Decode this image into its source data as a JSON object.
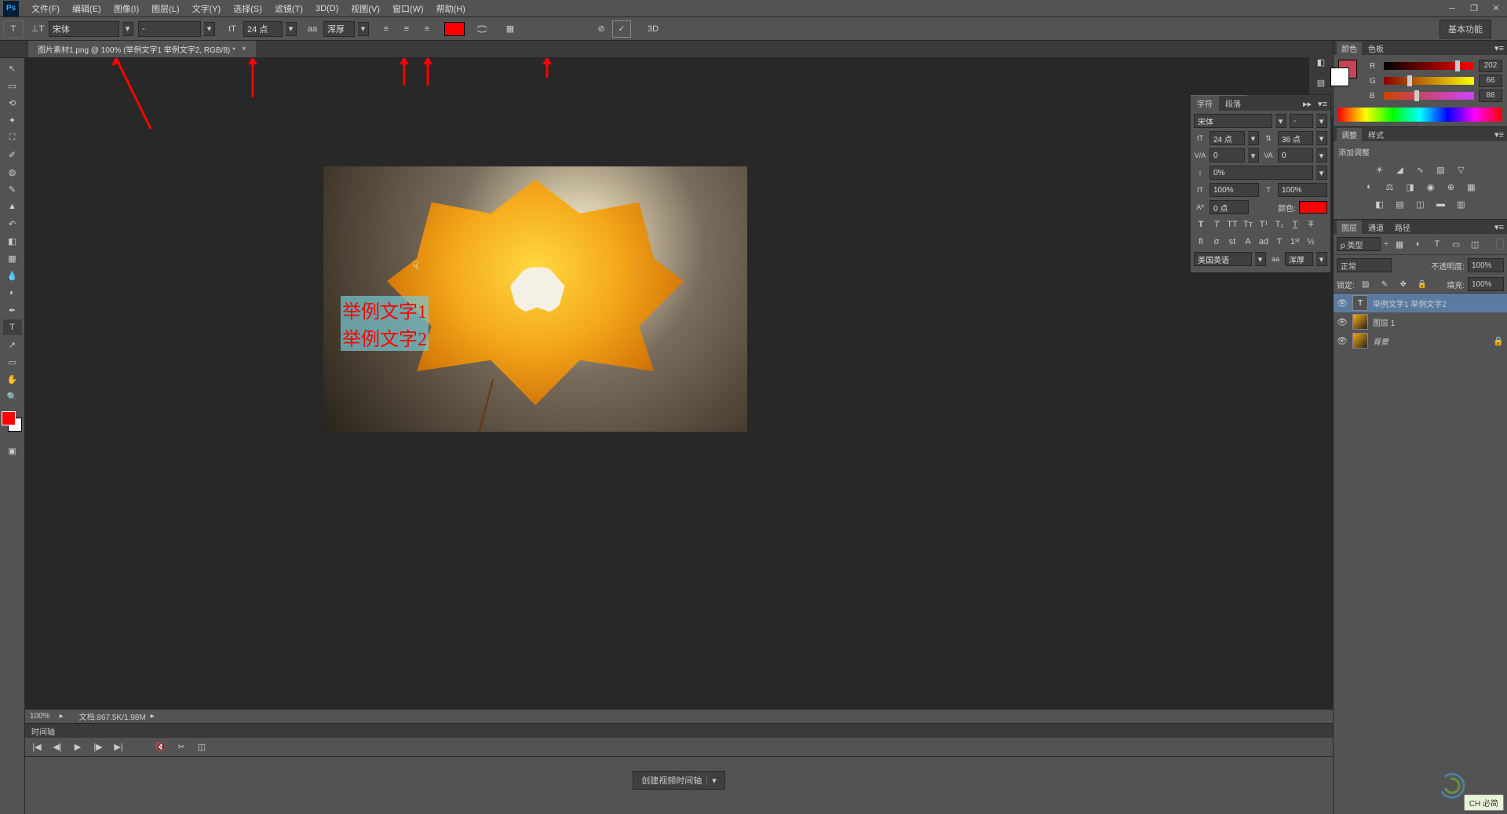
{
  "menubar": {
    "logo": "Ps",
    "items": [
      "文件(F)",
      "编辑(E)",
      "图像(I)",
      "图层(L)",
      "文字(Y)",
      "选择(S)",
      "滤镜(T)",
      "3D(D)",
      "视图(V)",
      "窗口(W)",
      "帮助(H)"
    ]
  },
  "optionsbar": {
    "font_family": "宋体",
    "font_style": "-",
    "font_size": "24 点",
    "aa_label": "aa",
    "aa_value": "浑厚",
    "threeD": "3D",
    "workspace": "基本功能"
  },
  "document": {
    "tab_title": "图片素材1.png @ 100% (举例文字1 举例文字2, RGB/8) *",
    "text1": "举例文字1",
    "text2": "举例文字2"
  },
  "statusbar": {
    "zoom": "100%",
    "docinfo": "文档:867.5K/1.98M"
  },
  "timeline": {
    "title": "时间轴",
    "create_btn": "创建视频时间轴"
  },
  "char_panel": {
    "tab1": "字符",
    "tab2": "段落",
    "font": "宋体",
    "style": "-",
    "size": "24 点",
    "leading": "36 点",
    "tracking": "0",
    "va": "0",
    "scale_label": "0%",
    "scale_h": "100%",
    "scale_v": "100%",
    "baseline": "0 点",
    "color_label": "颜色:",
    "lang": "美国英语",
    "aa": "浑厚"
  },
  "color_panel": {
    "tab1": "颜色",
    "tab2": "色板",
    "r_label": "R",
    "r_val": "202",
    "g_label": "G",
    "g_val": "66",
    "b_label": "B",
    "b_val": "88"
  },
  "adjustments": {
    "tab1": "调整",
    "tab2": "样式",
    "label": "添加调整"
  },
  "layers_panel": {
    "tab1": "图层",
    "tab2": "通道",
    "tab3": "路径",
    "filter": "ρ 类型",
    "blend": "正常",
    "opacity_label": "不透明度:",
    "opacity_val": "100%",
    "lock_label": "锁定:",
    "fill_label": "填充:",
    "fill_val": "100%",
    "layers": [
      {
        "name": "举例文字1 举例文字2",
        "type": "text",
        "selected": true
      },
      {
        "name": "图层 1",
        "type": "image",
        "selected": false
      },
      {
        "name": "背景",
        "type": "bg",
        "selected": false,
        "locked": true
      }
    ]
  },
  "ime": "CH 必简",
  "watermark_text": ""
}
